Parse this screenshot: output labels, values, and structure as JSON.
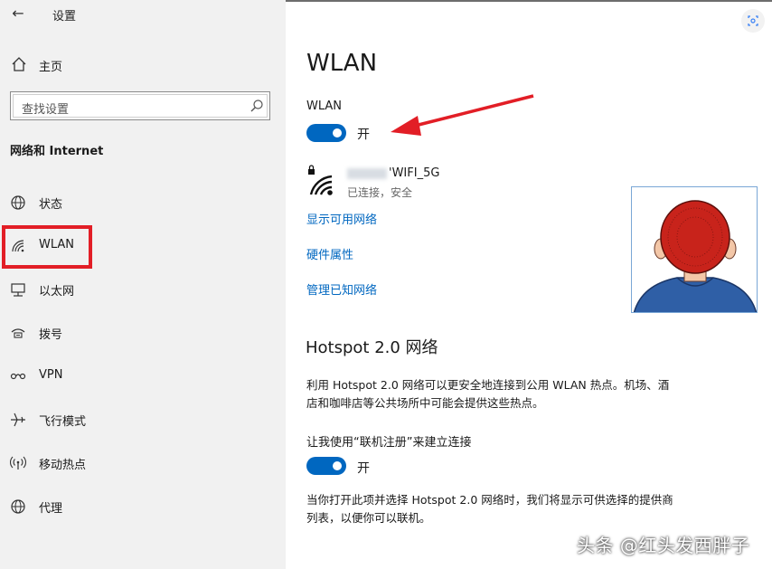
{
  "window": {
    "title": "设置",
    "back_glyph": "←"
  },
  "sidebar": {
    "home_label": "主页",
    "search": {
      "placeholder": "查找设置"
    },
    "section_title": "网络和 Internet",
    "items": [
      {
        "label": "状态",
        "icon": "status-globe-icon"
      },
      {
        "label": "WLAN",
        "icon": "wifi-icon"
      },
      {
        "label": "以太网",
        "icon": "ethernet-icon"
      },
      {
        "label": "拨号",
        "icon": "dialup-icon"
      },
      {
        "label": "VPN",
        "icon": "vpn-icon"
      },
      {
        "label": "飞行模式",
        "icon": "airplane-icon"
      },
      {
        "label": "移动热点",
        "icon": "hotspot-icon"
      },
      {
        "label": "代理",
        "icon": "globe-icon"
      }
    ]
  },
  "main": {
    "page_title": "WLAN",
    "wlan_label": "WLAN",
    "wlan_toggle_state": "开",
    "network": {
      "name_suffix": "'WIFI_5G",
      "status": "已连接，安全"
    },
    "links": [
      "显示可用网络",
      "硬件属性",
      "管理已知网络"
    ],
    "hotspot": {
      "title": "Hotspot 2.0 网络",
      "description_line1": "利用 Hotspot 2.0 网络可以更安全地连接到公用 WLAN 热点。机场、酒",
      "description_line2": "店和咖啡店等公共场所中可能会提供这些热点。",
      "signup_label": "让我使用“联机注册”来建立连接",
      "signup_toggle_state": "开",
      "note_line1": "当你打开此项并选择 Hotspot 2.0 网络时，我们将显示可供选择的提供商",
      "note_line2": "列表，以便你可以联机。"
    }
  },
  "watermark": "头条 @红头发西胖子",
  "colors": {
    "accent": "#0067c0",
    "highlight": "#e21e26",
    "sidebar_bg": "#f1f1f1"
  }
}
